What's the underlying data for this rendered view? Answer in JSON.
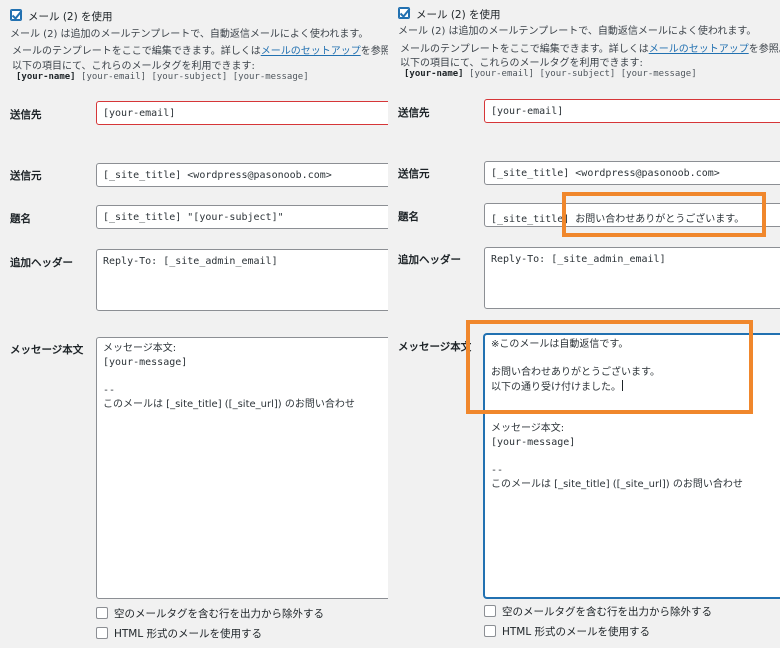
{
  "left": {
    "mail2_checkbox_label": "メール (2) を使用",
    "mail2_description": "メール (2) は追加のメールテンプレートで、自動返信メールによく使われます。",
    "help_text_pre": "メールのテンプレートをここで編集できます。詳しくは",
    "help_link": "メールのセットアップ",
    "help_text_post": "を参照。",
    "help_line2": "以下の項目にて、これらのメールタグを利用できます:",
    "tags": {
      "bold": "[your-name]",
      "rest": "[your-email] [your-subject] [your-message]"
    },
    "to_label": "送信先",
    "to_value": "[your-email]",
    "from_label": "送信元",
    "from_value": "[_site_title] <wordpress@pasonoob.com>",
    "subject_label": "題名",
    "subject_value": "[_site_title] \"[your-subject]\"",
    "headers_label": "追加ヘッダー",
    "headers_value": "Reply-To: [_site_admin_email]",
    "body_label": "メッセージ本文",
    "body_lines": [
      "メッセージ本文:",
      "[your-message]",
      "",
      "--",
      "このメールは [_site_title] ([_site_url]) のお問い合わせ"
    ],
    "exclude_blank_label": "空のメールタグを含む行を出力から除外する",
    "html_mail_label": "HTML 形式のメールを使用する"
  },
  "right": {
    "mail2_checkbox_label": "メール (2) を使用",
    "mail2_description": "メール (2) は追加のメールテンプレートで、自動返信メールによく使われます。",
    "help_text_pre": "メールのテンプレートをここで編集できます。詳しくは",
    "help_link": "メールのセットアップ",
    "help_text_post": "を参照。",
    "help_line2": "以下の項目にて、これらのメールタグを利用できます:",
    "tags": {
      "bold": "[your-name]",
      "rest": "[your-email] [your-subject] [your-message]"
    },
    "to_label": "送信先",
    "to_value": "[your-email]",
    "from_label": "送信元",
    "from_value": "[_site_title] <wordpress@pasonoob.com>",
    "subject_label": "題名",
    "subject_value": "[_site_title] お問い合わせありがとうございます。",
    "headers_label": "追加ヘッダー",
    "headers_value": "Reply-To: [_site_admin_email]",
    "body_label": "メッセージ本文",
    "body_lines": [
      "※このメールは自動返信です。",
      "",
      "お問い合わせありがとうございます。",
      "以下の通り受け付けました。",
      "",
      "",
      "メッセージ本文:",
      "[your-message]",
      "",
      "--",
      "このメールは [_site_title] ([_site_url]) のお問い合わせ"
    ],
    "exclude_blank_label": "空のメールタグを含む行を出力から除外する",
    "html_mail_label": "HTML 形式のメールを使用する"
  },
  "colors": {
    "highlight": "#f0872c",
    "accent": "#2271b1",
    "invalid": "#d63638"
  }
}
